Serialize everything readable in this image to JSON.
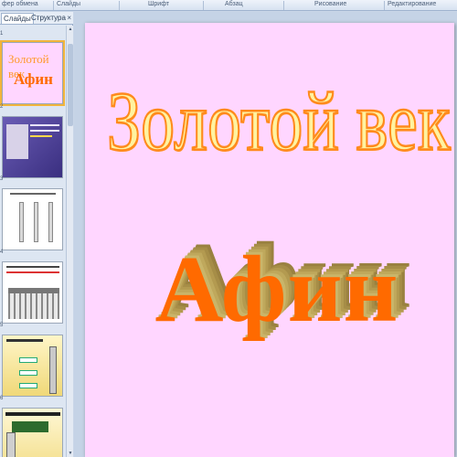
{
  "ribbon": {
    "groups": [
      "фер обмена",
      "Слайды",
      "Шрифт",
      "Абзац",
      "Рисование",
      "Редактирование"
    ]
  },
  "pane": {
    "tabs": [
      "Слайды",
      "Структура"
    ],
    "close": "×",
    "slide_numbers": [
      "1",
      "2",
      "3",
      "4",
      "5",
      "6"
    ]
  },
  "slide": {
    "title_line1": "Золотой век",
    "title_line2": "Афин"
  },
  "thumbnails": {
    "slide1_line1": "Золотой век",
    "slide1_line2": "Афин"
  },
  "colors": {
    "slide_background": "#ffd6ff",
    "title1_fill": "#fff3a0",
    "title1_outline": "#ff8a1c",
    "title2_fill": "#ff6a00",
    "title2_extrusion": "#b39a50",
    "selection": "#f2b43c"
  }
}
